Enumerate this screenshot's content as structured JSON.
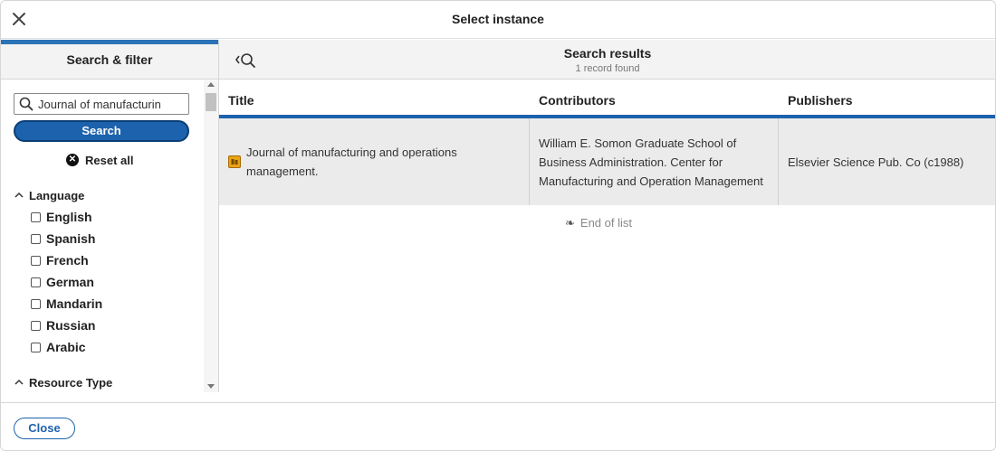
{
  "modal": {
    "title": "Select instance",
    "close_label": "Close"
  },
  "filters": {
    "header": "Search & filter",
    "search_value": "Journal of manufacturin",
    "search_button": "Search",
    "reset_label": "Reset all",
    "language_label": "Language",
    "languages": [
      "English",
      "Spanish",
      "French",
      "German",
      "Mandarin",
      "Russian",
      "Arabic"
    ],
    "resource_type_label": "Resource Type"
  },
  "results": {
    "title": "Search results",
    "count": "1 record found",
    "columns": [
      "Title",
      "Contributors",
      "Publishers"
    ],
    "rows": [
      {
        "title": "Journal of manufacturing and operations management.",
        "contributors": "William E. Somon Graduate School of Business Administration. Center for Manufacturing and Operation Management",
        "publishers": "Elsevier Science Pub. Co (c1988)"
      }
    ],
    "end_of_list": "End of list"
  },
  "colors": {
    "accent": "#1d62ad",
    "row_bg": "#ebebeb",
    "header_bg": "#f3f3f3",
    "type_icon": "#e8a317"
  }
}
